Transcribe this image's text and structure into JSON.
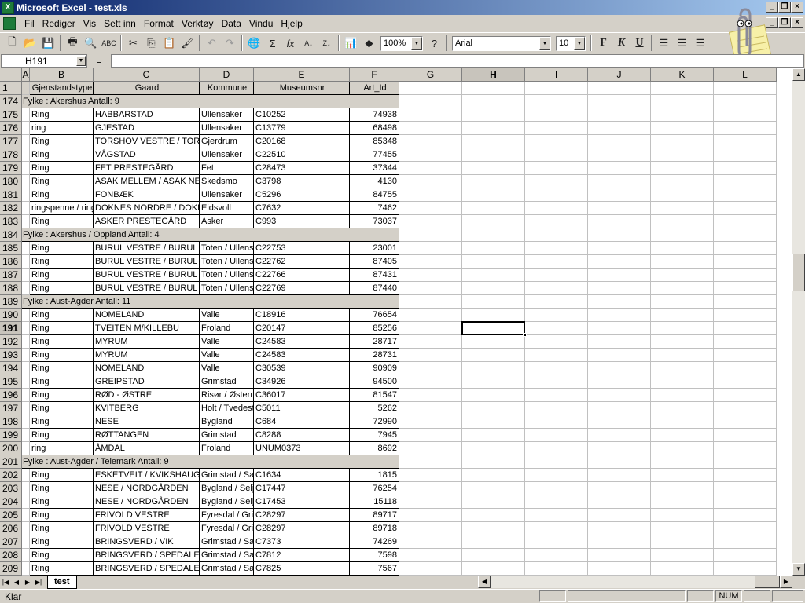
{
  "window": {
    "title": "Microsoft Excel - test.xls"
  },
  "menu": [
    "Fil",
    "Rediger",
    "Vis",
    "Sett inn",
    "Format",
    "Verktøy",
    "Data",
    "Vindu",
    "Hjelp"
  ],
  "toolbar": {
    "zoom": "100%",
    "font": "Arial",
    "font_size": "10",
    "bold": "F",
    "italic": "K",
    "underline": "U"
  },
  "formula_bar": {
    "name_box": "H191",
    "equals": "=",
    "content": ""
  },
  "columns": [
    {
      "letter": "A"
    },
    {
      "letter": "B"
    },
    {
      "letter": "C"
    },
    {
      "letter": "D"
    },
    {
      "letter": "E"
    },
    {
      "letter": "F"
    },
    {
      "letter": "G"
    },
    {
      "letter": "H"
    },
    {
      "letter": "I"
    },
    {
      "letter": "J"
    },
    {
      "letter": "K"
    },
    {
      "letter": "L"
    }
  ],
  "header_row": {
    "num": "1",
    "cells": [
      "Gjenstandstype",
      "Gaard",
      "Kommune",
      "Museumsnr",
      "Art_Id"
    ]
  },
  "rows": [
    {
      "num": "174",
      "group": "Fylke : Akershus  Antall: 9"
    },
    {
      "num": "175",
      "cells": [
        "Ring",
        "HABBARSTAD",
        "Ullensaker",
        "C10252",
        "74938"
      ]
    },
    {
      "num": "176",
      "cells": [
        "ring",
        "GJESTAD",
        "Ullensaker",
        "C13779",
        "68498"
      ]
    },
    {
      "num": "177",
      "cells": [
        "Ring",
        "TORSHOV VESTRE / TORSHOV",
        "Gjerdrum",
        "C20168",
        "85348"
      ]
    },
    {
      "num": "178",
      "cells": [
        "Ring",
        "VÅGSTAD",
        "Ullensaker",
        "C22510",
        "77455"
      ]
    },
    {
      "num": "179",
      "cells": [
        "Ring",
        "FET PRESTEGÅRD",
        "Fet",
        "C28473",
        "37344"
      ]
    },
    {
      "num": "180",
      "cells": [
        "Ring",
        "ASAK MELLEM / ASAK NEDRE",
        "Skedsmo",
        "C3798",
        "4130"
      ]
    },
    {
      "num": "181",
      "cells": [
        "Ring",
        "FONBÆK",
        "Ullensaker",
        "C5296",
        "84755"
      ]
    },
    {
      "num": "182",
      "cells": [
        "ringspenne / ring",
        "DOKNES NORDRE / DOKNES",
        "Eidsvoll",
        "C7632",
        "7462"
      ]
    },
    {
      "num": "183",
      "cells": [
        "Ring",
        "ASKER PRESTEGÅRD",
        "Asker",
        "C993",
        "73037"
      ]
    },
    {
      "num": "184",
      "group": "Fylke : Akershus / Oppland  Antall: 4"
    },
    {
      "num": "185",
      "cells": [
        "Ring",
        "BURUL VESTRE / BURUL",
        "Toten / Ullensaker",
        "C22753",
        "23001"
      ]
    },
    {
      "num": "186",
      "cells": [
        "Ring",
        "BURUL VESTRE / BURUL",
        "Toten / Ullensaker",
        "C22762",
        "87405"
      ]
    },
    {
      "num": "187",
      "cells": [
        "Ring",
        "BURUL VESTRE / BURUL",
        "Toten / Ullensaker",
        "C22766",
        "87431"
      ]
    },
    {
      "num": "188",
      "cells": [
        "Ring",
        "BURUL VESTRE / BURUL",
        "Toten / Ullensaker",
        "C22769",
        "87440"
      ]
    },
    {
      "num": "189",
      "group": "Fylke : Aust-Agder  Antall: 11"
    },
    {
      "num": "190",
      "cells": [
        "Ring",
        "NOMELAND",
        "Valle",
        "C18916",
        "76654"
      ]
    },
    {
      "num": "191",
      "cells": [
        "Ring",
        "TVEITEN M/KILLEBU",
        "Froland",
        "C20147",
        "85256"
      ]
    },
    {
      "num": "192",
      "cells": [
        "Ring",
        "MYRUM",
        "Valle",
        "C24583",
        "28717"
      ]
    },
    {
      "num": "193",
      "cells": [
        "Ring",
        "MYRUM",
        "Valle",
        "C24583",
        "28731"
      ]
    },
    {
      "num": "194",
      "cells": [
        "Ring",
        "NOMELAND",
        "Valle",
        "C30539",
        "90909"
      ]
    },
    {
      "num": "195",
      "cells": [
        "Ring",
        "GREIPSTAD",
        "Grimstad",
        "C34926",
        "94500"
      ]
    },
    {
      "num": "196",
      "cells": [
        "Ring",
        "RØD - ØSTRE",
        "Risør / Østerrisør",
        "C36017",
        "81547"
      ]
    },
    {
      "num": "197",
      "cells": [
        "Ring",
        "KVITBERG",
        "Holt / Tvedestrand",
        "C5011",
        "5262"
      ]
    },
    {
      "num": "198",
      "cells": [
        "Ring",
        "NESE",
        "Bygland",
        "C684",
        "72990"
      ]
    },
    {
      "num": "199",
      "cells": [
        "Ring",
        "RØTTANGEN",
        "Grimstad",
        "C8288",
        "7945"
      ]
    },
    {
      "num": "200",
      "cells": [
        "ring",
        "ÅMDAL",
        "Froland",
        "UNUM0373",
        "8692"
      ]
    },
    {
      "num": "201",
      "group": "Fylke : Aust-Agder / Telemark  Antall: 9"
    },
    {
      "num": "202",
      "cells": [
        "Ring",
        "ESKETVEIT / KVIKSHAUG",
        "Grimstad / Sauherad",
        "C1634",
        "1815"
      ]
    },
    {
      "num": "203",
      "cells": [
        "Ring",
        "NESE / NORDGÅRDEN",
        "Bygland / Seljord",
        "C17447",
        "76254"
      ]
    },
    {
      "num": "204",
      "cells": [
        "Ring",
        "NESE / NORDGÅRDEN",
        "Bygland / Seljord",
        "C17453",
        "15118"
      ]
    },
    {
      "num": "205",
      "cells": [
        "Ring",
        "FRIVOLD VESTRE",
        "Fyresdal / Grimstad",
        "C28297",
        "89717"
      ]
    },
    {
      "num": "206",
      "cells": [
        "Ring",
        "FRIVOLD VESTRE",
        "Fyresdal / Grimstad",
        "C28297",
        "89718"
      ]
    },
    {
      "num": "207",
      "cells": [
        "Ring",
        "BRINGSVERD / VIK",
        "Grimstad / Sauherad",
        "C7373",
        "74269"
      ]
    },
    {
      "num": "208",
      "cells": [
        "Ring",
        "BRINGSVERD / SPEDALEN",
        "Grimstad / Sauherad",
        "C7812",
        "7598"
      ]
    },
    {
      "num": "209",
      "cells": [
        "Ring",
        "BRINGSVERD / SPEDALEN",
        "Grimstad / Sauherad",
        "C7825",
        "7567"
      ]
    }
  ],
  "selected": {
    "column": "H",
    "row": "191"
  },
  "sheet_tab": "test",
  "status": {
    "text": "Klar",
    "num": "NUM"
  },
  "colors": {
    "title_gradient_start": "#0a246a",
    "title_gradient_end": "#a6caf0",
    "chrome": "#d4d0c8"
  }
}
